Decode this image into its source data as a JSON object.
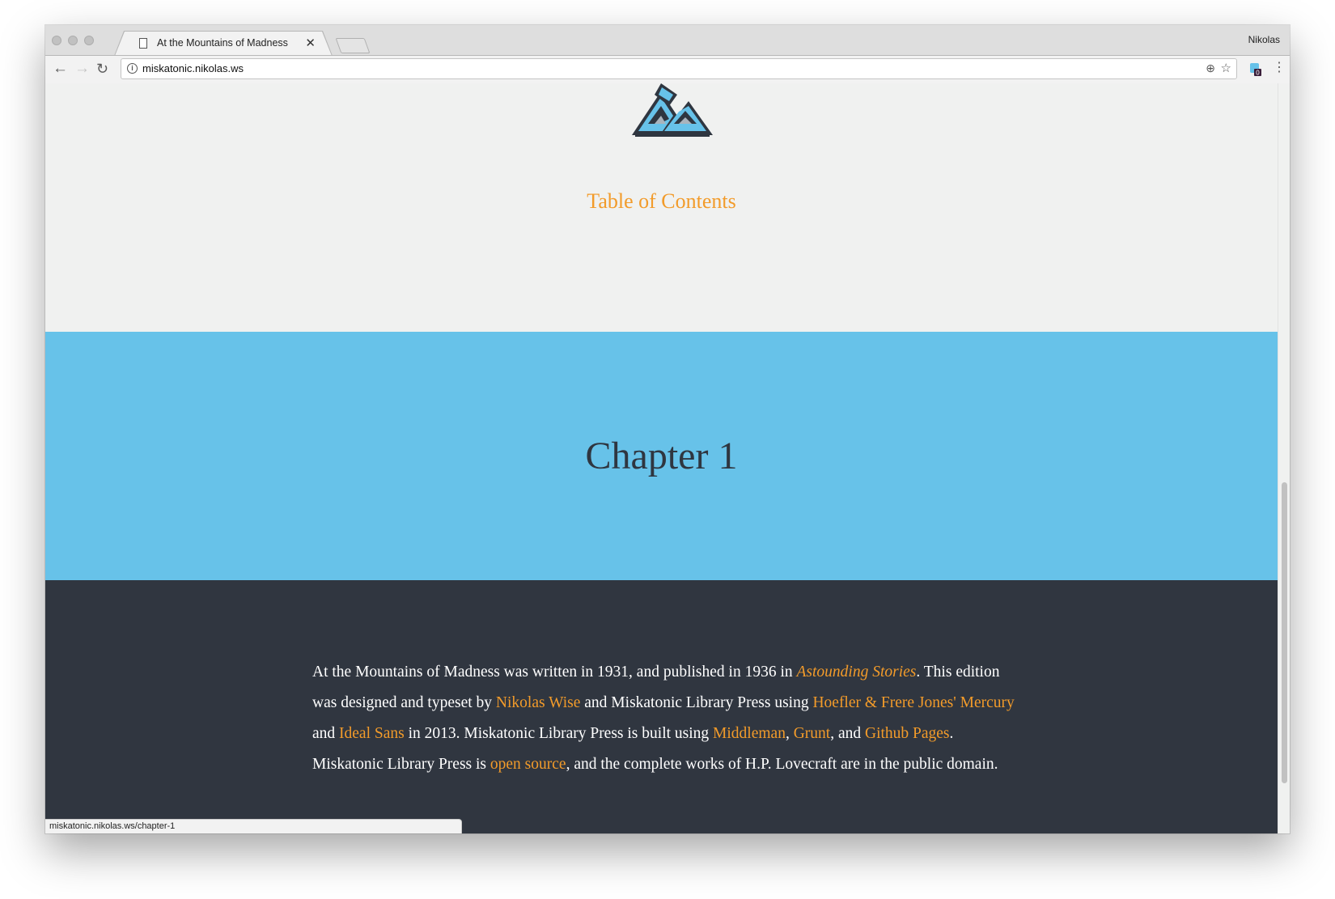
{
  "browser": {
    "tab": {
      "title": "At the Mountains of Madness"
    },
    "profile_name": "Nikolas",
    "url": "miskatonic.nikolas.ws",
    "status_url": "miskatonic.nikolas.ws/chapter-1",
    "extension_badge": "0"
  },
  "page": {
    "toc_link": "Table of Contents",
    "chapter_title": "Chapter 1",
    "colophon": {
      "t1": "At the Mountains of Madness was written in 1931, and published in 1936 in ",
      "link_astounding": "Astounding Stories",
      "t2": ". This edition was designed and typeset by ",
      "link_author": "Nikolas Wise",
      "t3": " and Miskatonic Library Press using ",
      "link_mercury": "Hoefler & Frere Jones' Mercury",
      "t4": " and ",
      "link_ideal": "Ideal Sans",
      "t5": " in 2013. Miskatonic Library Press is built using ",
      "link_middleman": "Middleman",
      "t6": ", ",
      "link_grunt": "Grunt",
      "t7": ", and ",
      "link_github": "Github Pages",
      "t8": ". Miskatonic Library Press is ",
      "link_opensource": "open source",
      "t9": ", and the complete works of H.P. Lovecraft are in the public domain."
    }
  },
  "colors": {
    "accent_orange": "#f29b2a",
    "chapter_band": "#67c2e9",
    "dark_band": "#303640",
    "hero_bg": "#f0f1f0"
  }
}
